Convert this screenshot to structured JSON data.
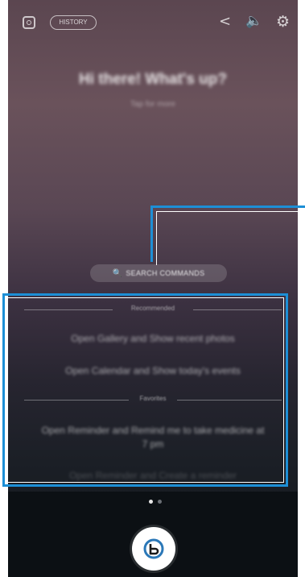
{
  "topbar": {
    "history_label": "HISTORY"
  },
  "greeting": {
    "title": "Hi there! What's up?",
    "subtitle": "Tap for more"
  },
  "search": {
    "label": "SEARCH COMMANDS"
  },
  "commands": {
    "recommended_header": "Recommended",
    "recommended": [
      "Open Gallery and Show recent photos",
      "Open Calendar and Show today's events"
    ],
    "favorites_header": "Favorites",
    "favorites": [
      "Open Reminder and Remind me to take medicine at 7 pm",
      "Open Reminder and Create a reminder"
    ]
  },
  "pager": {
    "active_color": "#e6e6e6",
    "inactive_color": "#6b6f75"
  },
  "colors": {
    "callout_blue": "#1d8fd6",
    "mic_accent": "#2b78b8"
  }
}
